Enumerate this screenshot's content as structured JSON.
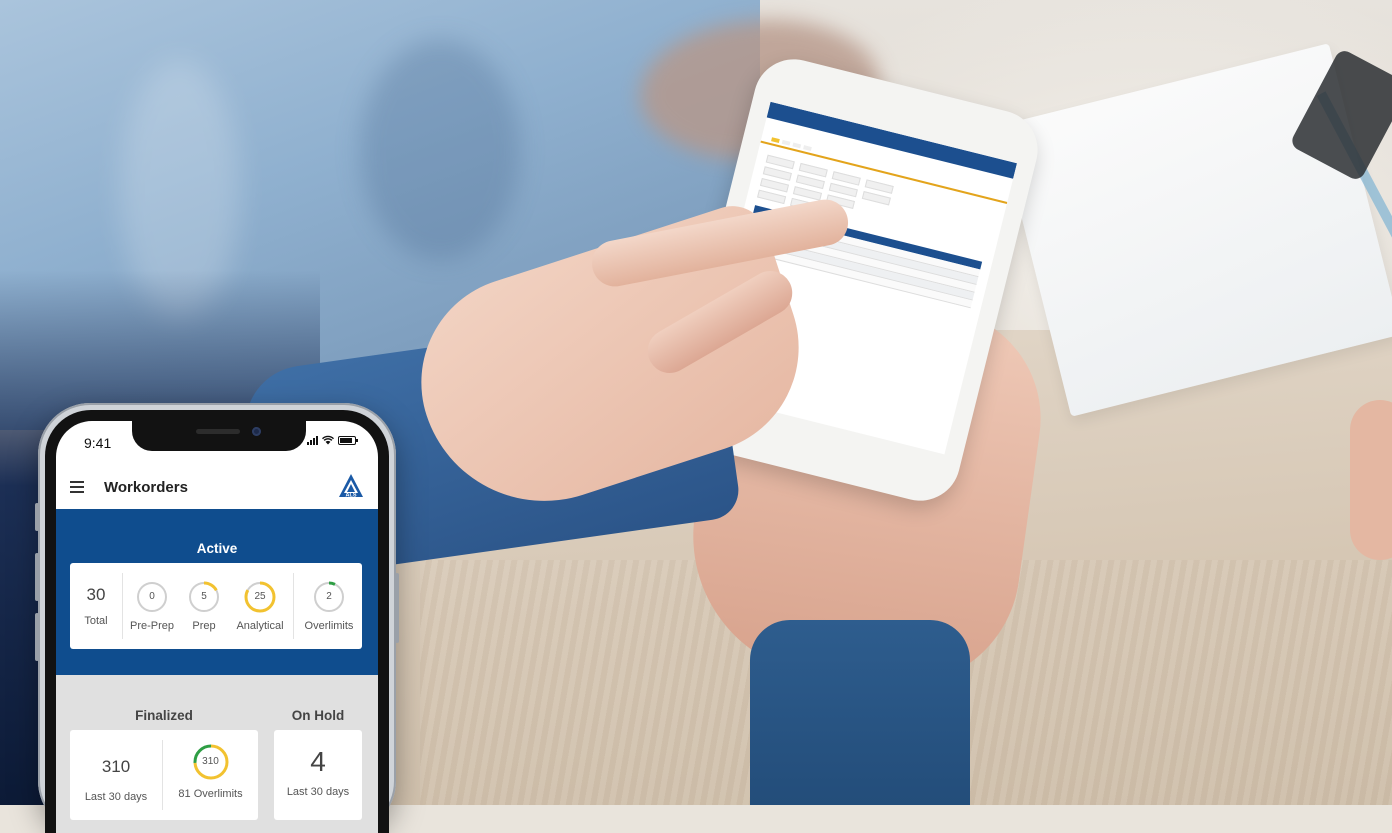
{
  "status_bar": {
    "time": "9:41"
  },
  "header": {
    "title": "Workorders",
    "logo_text": "ALS",
    "menu_icon": "hamburger-menu-icon"
  },
  "active": {
    "title": "Active",
    "total": {
      "value": "30",
      "label": "Total"
    },
    "pre_prep": {
      "value": "0",
      "label": "Pre-Prep",
      "progress": 0,
      "color": "#cccccc"
    },
    "prep": {
      "value": "5",
      "label": "Prep",
      "progress": 0.17,
      "color": "#f2c230"
    },
    "analytical": {
      "value": "25",
      "label": "Analytical",
      "progress": 0.83,
      "color": "#f2c230"
    },
    "overlimits": {
      "value": "2",
      "label": "Overlimits",
      "progress": 0.07,
      "color": "#2e9e44"
    }
  },
  "finalized": {
    "title": "Finalized",
    "count": {
      "value": "310",
      "label": "Last 30 days"
    },
    "overlimits": {
      "ring_value": "310",
      "label": "81 Overlimits",
      "progress": 0.74,
      "color": "#f2c230",
      "accent": "#2e9e44"
    }
  },
  "on_hold": {
    "title": "On Hold",
    "count": {
      "value": "4",
      "label": "Last 30 days"
    }
  },
  "colors": {
    "primary_blue": "#0f4d8e",
    "ring_track": "#cfcfcf",
    "panel_gray": "#e0e0e0"
  }
}
